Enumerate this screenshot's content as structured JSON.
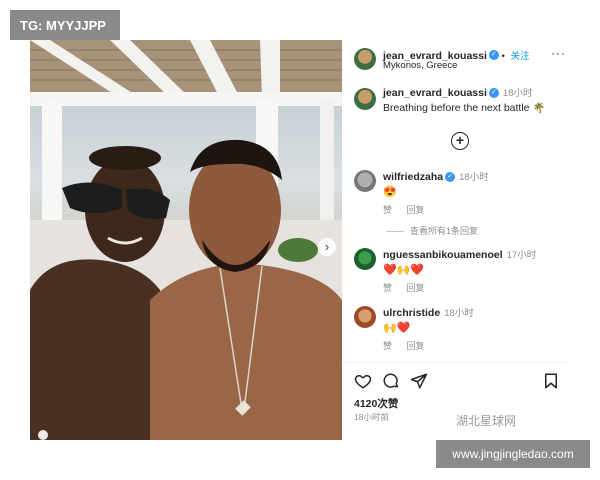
{
  "watermark_top": "TG: MYYJJPP",
  "watermark_bottom": "www.jingjingledao.com",
  "watermark_sport": "湖北星球网",
  "post": {
    "author": "jean_evrard_kouassi",
    "follow_label": "关注",
    "location": "Mykonos, Greece",
    "caption_time": "18小时",
    "caption_text": "Breathing before the next battle",
    "caption_emoji": "🌴",
    "more_icon": "more-dots-icon"
  },
  "comments": [
    {
      "user": "wilfriedzaha",
      "verified": true,
      "time": "18小时",
      "emoji": "😍",
      "actions": [
        "赞",
        "回复"
      ]
    },
    {
      "user": "nguessanbikouamenoel",
      "verified": false,
      "time": "17小时",
      "emoji": "❤️🙌❤️",
      "actions": [
        "赞",
        "回复"
      ]
    },
    {
      "user": "ulrchristide",
      "verified": false,
      "time": "18小时",
      "emoji": "🙌❤️",
      "actions": [
        "赞",
        "回复"
      ]
    }
  ],
  "view_replies": "查看所有1条回复",
  "action_icons": [
    "heart-icon",
    "comment-icon",
    "share-icon",
    "bookmark-icon"
  ],
  "likes": "4120次赞",
  "post_time": "18小时前",
  "colors": {
    "link_blue": "#0095f6",
    "verified_blue": "#3897f0",
    "heart_red": "#ed4956",
    "watermark_gray": "#8a8a8a"
  }
}
